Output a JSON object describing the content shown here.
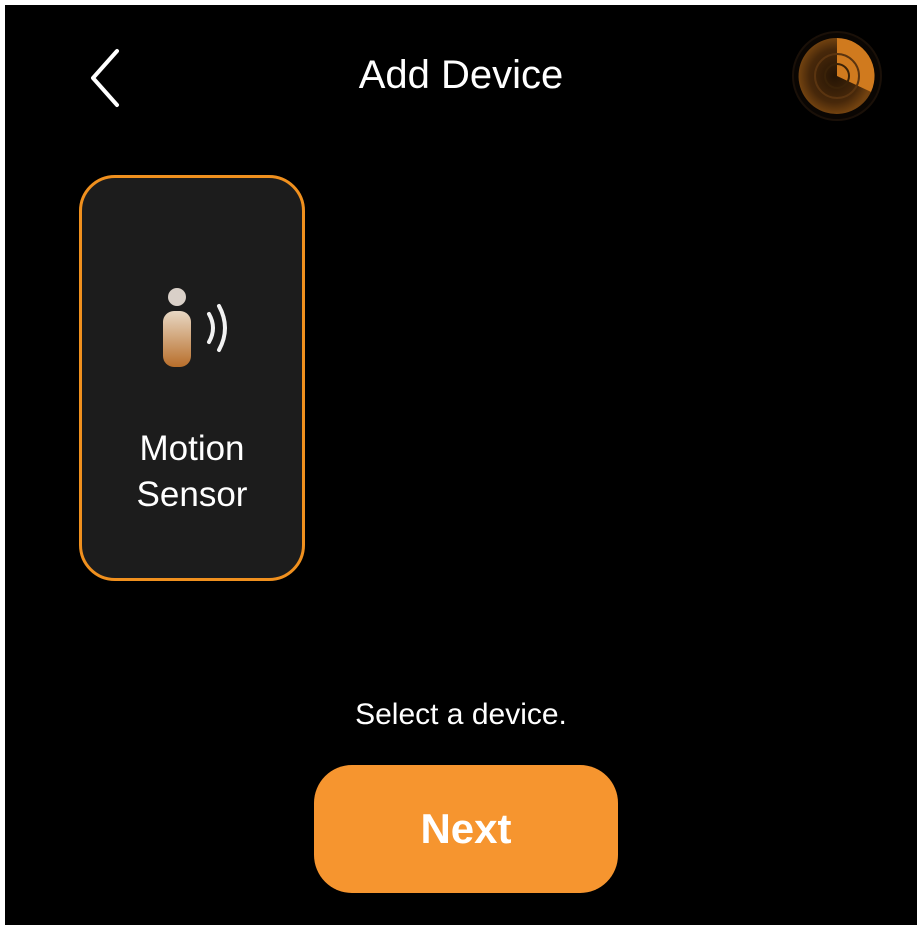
{
  "header": {
    "title": "Add Device",
    "back_icon": "chevron-left-icon",
    "status_icon": "radar-spinner-icon"
  },
  "devices": [
    {
      "label_line1": "Motion",
      "label_line2": "Sensor",
      "icon": "motion-sensor-icon",
      "selected": true
    }
  ],
  "footer": {
    "hint": "Select a device.",
    "next_label": "Next"
  },
  "colors": {
    "background": "#000000",
    "accent": "#f6952f",
    "card_border": "#f0901e",
    "card_background": "#1c1c1c",
    "text": "#ffffff"
  }
}
